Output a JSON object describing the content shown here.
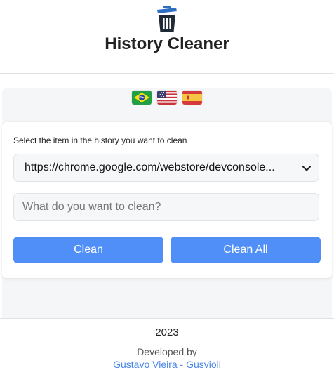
{
  "header": {
    "icon": "trash-can-icon",
    "title": "History Cleaner"
  },
  "languages": [
    {
      "name": "brazil-flag-icon",
      "code": "pt-BR"
    },
    {
      "name": "usa-flag-icon",
      "code": "en-US"
    },
    {
      "name": "spain-flag-icon",
      "code": "es"
    }
  ],
  "form": {
    "instruction": "Select the item in the history you want to clean",
    "selected_url": "https://chrome.google.com/webstore/devconsole...",
    "search_placeholder": "What do you want to clean?",
    "search_value": "",
    "clean_label": "Clean",
    "clean_all_label": "Clean All"
  },
  "footer": {
    "year": "2023",
    "developed_by": "Developed by",
    "author": "Gustavo Vieira - Gusvioli"
  },
  "colors": {
    "accent": "#4f8ff7",
    "link": "#4a86e8",
    "panel_bg": "#f5f6f7",
    "icon_dark": "#1e2a36",
    "icon_lid": "#2f6fc2"
  }
}
